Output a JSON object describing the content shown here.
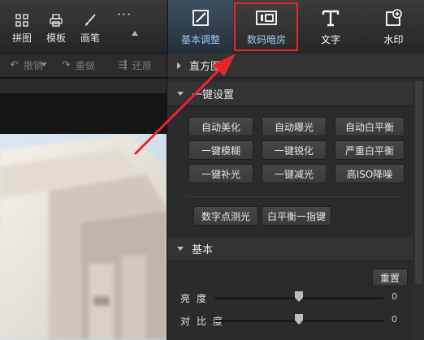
{
  "toolbar": {
    "pintu": "拼图",
    "muban": "模板",
    "huabi": "画笔",
    "more": "···"
  },
  "tabs": {
    "basic": "基本调整",
    "darkroom": "数码暗房",
    "text": "文字",
    "watermark": "水印"
  },
  "undobar": {
    "undo": "撤销",
    "redo": "重做",
    "restore": "还原"
  },
  "panel": {
    "histogram": "直方图",
    "one_click_title": "一键设置",
    "one_click_buttons": [
      "自动美化",
      "自动曝光",
      "自动白平衡",
      "一键模糊",
      "一键锐化",
      "严重白平衡",
      "一键补光",
      "一键减光",
      "高ISO降噪"
    ],
    "extra_buttons": [
      "数字点测光",
      "白平衡一指键"
    ],
    "basic_title": "基本",
    "reset": "重置",
    "sliders": [
      {
        "label": "亮度",
        "value": "0",
        "level": 0.5
      },
      {
        "label": "对比度",
        "value": "0",
        "level": 0.5
      }
    ]
  },
  "colors": {
    "highlight": "#e8262a",
    "active_tab_text": "#9cc8f0"
  }
}
